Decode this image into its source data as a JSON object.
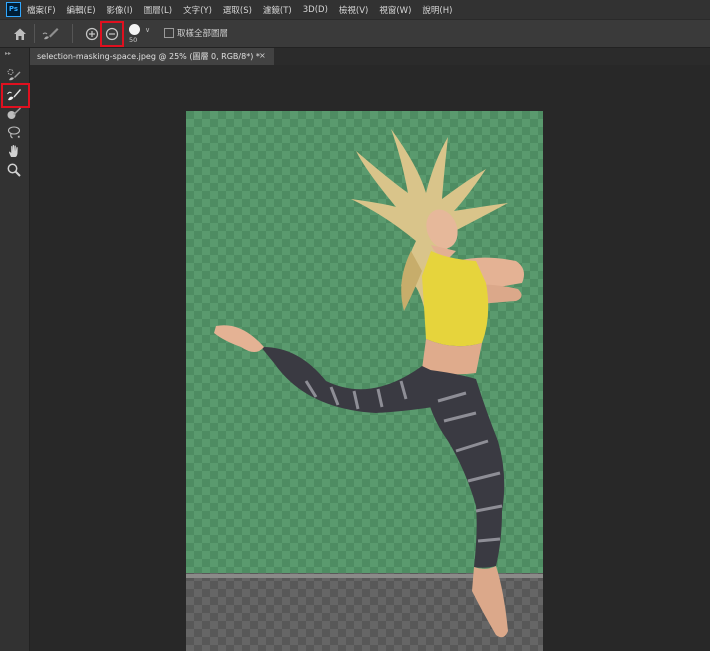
{
  "app": {
    "logo": "Ps"
  },
  "menu": [
    "檔案(F)",
    "編輯(E)",
    "影像(I)",
    "圖層(L)",
    "文字(Y)",
    "選取(S)",
    "濾鏡(T)",
    "3D(D)",
    "檢視(V)",
    "視窗(W)",
    "說明(H)"
  ],
  "options": {
    "brush_size": "50",
    "sample_all_layers_label": "取樣全部圖層",
    "sample_all_layers_checked": false,
    "active_mode": "subtract"
  },
  "tools": [
    "quick-selection",
    "refine-edge-brush",
    "brush",
    "lasso",
    "hand",
    "zoom"
  ],
  "active_tool": "refine-edge-brush",
  "document": {
    "tab_title": "selection-masking-space.jpeg @ 25% (圖層 0, RGB/8*) *",
    "close_glyph": "×"
  },
  "colors": {
    "highlight": "#e0101f",
    "overlay_green": "#4e8c62"
  }
}
